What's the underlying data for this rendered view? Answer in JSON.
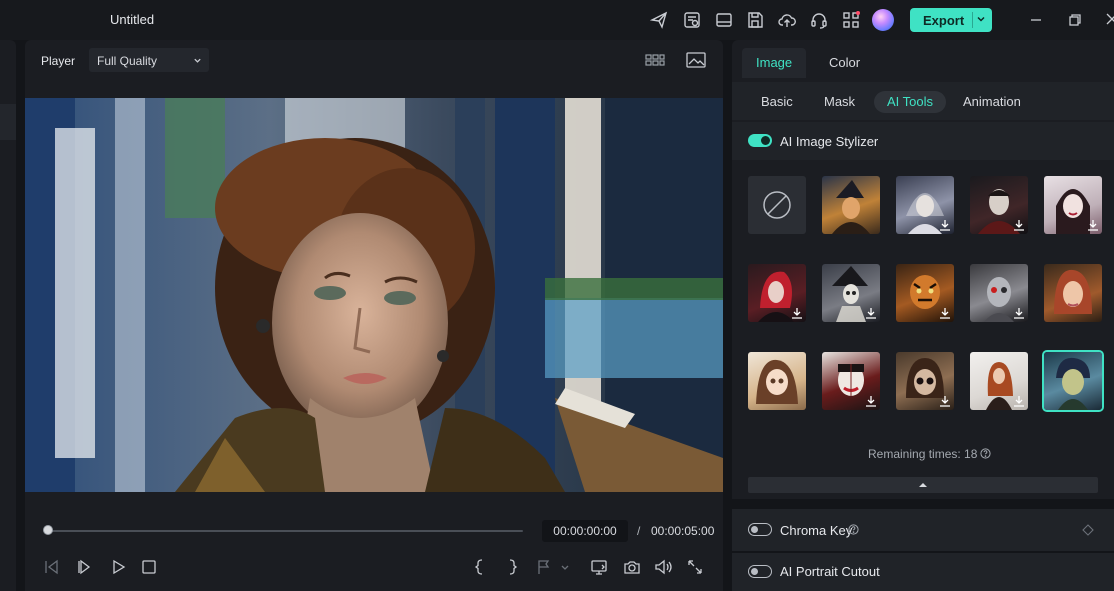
{
  "app": {
    "title": "Untitled",
    "accent": "#3fe2c4"
  },
  "toolbar": {
    "icons": [
      "send-icon",
      "task-list-icon",
      "layout-icon",
      "save-icon",
      "cloud-upload-icon",
      "headset-icon",
      "apps-grid-icon",
      "ai-assistant-icon"
    ],
    "export_label": "Export"
  },
  "player": {
    "label": "Player",
    "quality": "Full Quality",
    "current_time": "00:00:00:00",
    "separator": "/",
    "total_time": "00:00:05:00",
    "progress": 0
  },
  "panel": {
    "tabs": [
      "Image",
      "Color"
    ],
    "active_tab": "Image",
    "subtabs": [
      "Basic",
      "Mask",
      "AI Tools",
      "Animation"
    ],
    "active_subtab": "AI Tools",
    "stylizer": {
      "label": "AI Image Stylizer",
      "enabled": true,
      "styles": [
        {
          "name": "none",
          "download": false,
          "selected": false
        },
        {
          "name": "witch-style",
          "download": false,
          "selected": false
        },
        {
          "name": "ghost-bride-style",
          "download": true,
          "selected": false
        },
        {
          "name": "vampire-man-style",
          "download": true,
          "selected": false
        },
        {
          "name": "elf-vampire-style",
          "download": true,
          "selected": false
        },
        {
          "name": "red-hair-gothic-style",
          "download": true,
          "selected": false
        },
        {
          "name": "skeleton-witch-style",
          "download": true,
          "selected": false
        },
        {
          "name": "tiger-mask-style",
          "download": true,
          "selected": false
        },
        {
          "name": "cyborg-style",
          "download": true,
          "selected": false
        },
        {
          "name": "oil-portrait-style",
          "download": false,
          "selected": false
        },
        {
          "name": "anime-girl-style",
          "download": false,
          "selected": false
        },
        {
          "name": "clown-face-style",
          "download": true,
          "selected": false
        },
        {
          "name": "doll-style",
          "download": true,
          "selected": false
        },
        {
          "name": "photo-woman-style",
          "download": true,
          "selected": false
        },
        {
          "name": "painted-boy-style",
          "download": false,
          "selected": true
        }
      ],
      "remaining": "Remaining times: 18"
    },
    "chroma_key": {
      "label": "Chroma Key",
      "enabled": false
    },
    "portrait_cutout": {
      "label": "AI Portrait Cutout",
      "enabled": false
    }
  }
}
